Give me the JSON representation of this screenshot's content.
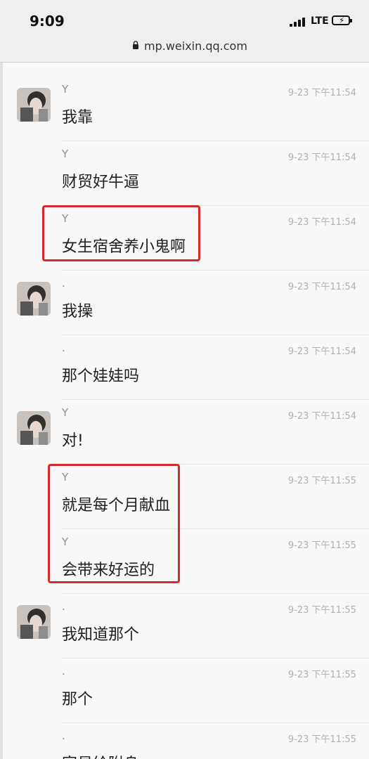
{
  "status_bar": {
    "time": "9:09",
    "network": "LTE",
    "icons": [
      "signal-bars-icon",
      "battery-charging-icon"
    ]
  },
  "url_bar": {
    "url": "mp.weixin.qq.com",
    "icon": "lock-icon"
  },
  "colors": {
    "highlight": "#d22d2d",
    "timestamp": "#b0b0b0",
    "sender": "#8c8c8c"
  },
  "messages": [
    {
      "sender": "Y",
      "time": "9-23 下午11:54",
      "text": "我靠",
      "avatar": true
    },
    {
      "sender": "Y",
      "time": "9-23 下午11:54",
      "text": "财贸好牛逼",
      "avatar": false
    },
    {
      "sender": "Y",
      "time": "9-23 下午11:54",
      "text": "女生宿舍养小鬼啊",
      "avatar": false,
      "highlighted": true
    },
    {
      "sender": ".",
      "time": "9-23 下午11:54",
      "text": "我操",
      "avatar": true
    },
    {
      "sender": ".",
      "time": "9-23 下午11:54",
      "text": "那个娃娃吗",
      "avatar": false
    },
    {
      "sender": "Y",
      "time": "9-23 下午11:54",
      "text": "对!",
      "avatar": true
    },
    {
      "sender": "Y",
      "time": "9-23 下午11:55",
      "text": "就是每个月献血",
      "avatar": false,
      "highlighted": true
    },
    {
      "sender": "Y",
      "time": "9-23 下午11:55",
      "text": "会带来好运的",
      "avatar": false,
      "highlighted": true
    },
    {
      "sender": ".",
      "time": "9-23 下午11:55",
      "text": "我知道那个",
      "avatar": true
    },
    {
      "sender": ".",
      "time": "9-23 下午11:55",
      "text": "那个",
      "avatar": false
    },
    {
      "sender": ".",
      "time": "9-23 下午11:55",
      "text": "容易给附身",
      "avatar": false
    }
  ]
}
